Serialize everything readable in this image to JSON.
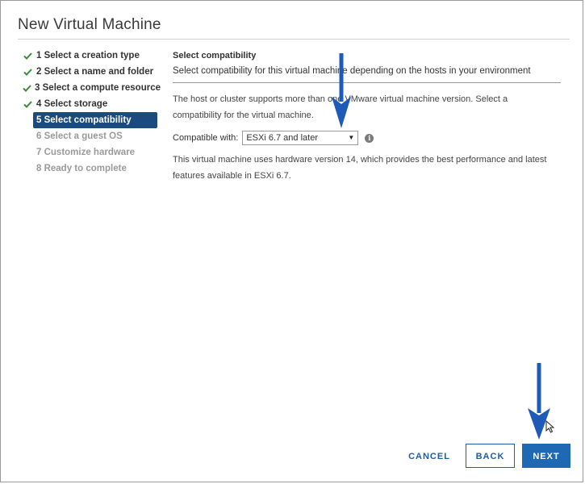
{
  "window": {
    "title": "New Virtual Machine"
  },
  "steps": [
    {
      "label": "1 Select a creation type",
      "state": "done"
    },
    {
      "label": "2 Select a name and folder",
      "state": "done"
    },
    {
      "label": "3 Select a compute resource",
      "state": "done"
    },
    {
      "label": "4 Select storage",
      "state": "done"
    },
    {
      "label": "5 Select compatibility",
      "state": "active"
    },
    {
      "label": "6 Select a guest OS",
      "state": "pending"
    },
    {
      "label": "7 Customize hardware",
      "state": "pending"
    },
    {
      "label": "8 Ready to complete",
      "state": "pending"
    }
  ],
  "content": {
    "title": "Select compatibility",
    "description": "Select compatibility for this virtual machine depending on the hosts in your environment",
    "info_text": "The host or cluster supports more than one VMware virtual machine version. Select a compatibility for the virtual machine.",
    "compat_label": "Compatible with:",
    "compat_value": "ESXi 6.7 and later",
    "hardware_text": "This virtual machine uses hardware version 14, which provides the best performance and latest features available in ESXi 6.7."
  },
  "footer": {
    "cancel_label": "CANCEL",
    "back_label": "BACK",
    "next_label": "NEXT"
  },
  "colors": {
    "accent": "#1f69b4",
    "active_step_bg": "#1a4a7e",
    "check": "#3c8a3c",
    "annotation_arrow": "#1e5bb8"
  },
  "icons": {
    "check": "check-icon",
    "dropdown": "caret-down-icon",
    "info": "info-icon",
    "annotation": "arrow-down-annotation-icon"
  }
}
